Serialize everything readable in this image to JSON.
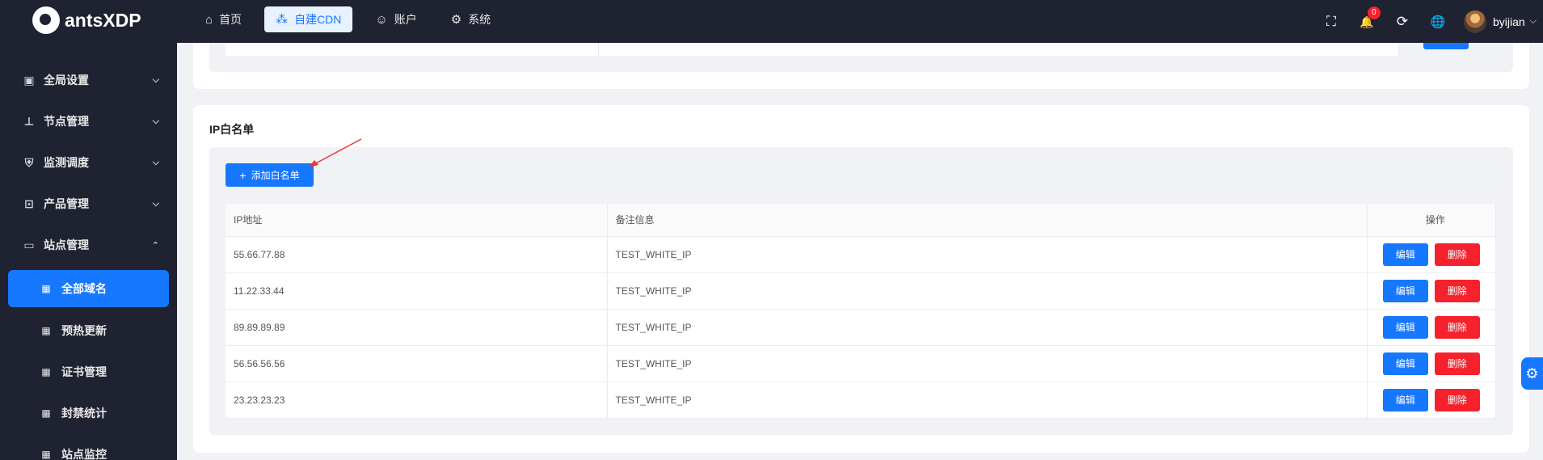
{
  "brand": {
    "name": "antsXDP"
  },
  "topnav": [
    {
      "label": "首页",
      "icon": "home-icon",
      "glyph": "⌂"
    },
    {
      "label": "自建CDN",
      "icon": "network-icon",
      "glyph": "⁂"
    },
    {
      "label": "账户",
      "icon": "user-icon",
      "glyph": "☺"
    },
    {
      "label": "系统",
      "icon": "gear-icon",
      "glyph": "⚙"
    }
  ],
  "header": {
    "notification_count": "0",
    "username": "byijian",
    "icons": {
      "fullscreen": "⛶",
      "bell": "🔔",
      "refresh": "⟳",
      "globe": "🌐",
      "caret": "⌵"
    }
  },
  "sidebar": {
    "items": [
      {
        "label": "全局设置",
        "glyph": "▣",
        "chev": "⌵"
      },
      {
        "label": "节点管理",
        "glyph": "⊥",
        "chev": "⌵"
      },
      {
        "label": "监测调度",
        "glyph": "⛨",
        "chev": "⌵"
      },
      {
        "label": "产品管理",
        "glyph": "⊡",
        "chev": "⌵"
      },
      {
        "label": "站点管理",
        "glyph": "▭",
        "chev": "⌃"
      }
    ],
    "sub_items": [
      {
        "label": "全部域名",
        "glyph": "▦"
      },
      {
        "label": "预热更新",
        "glyph": "▦"
      },
      {
        "label": "证书管理",
        "glyph": "▦"
      },
      {
        "label": "封禁统计",
        "glyph": "▦"
      },
      {
        "label": "站点监控",
        "glyph": "▦"
      }
    ]
  },
  "whitelist": {
    "title": "IP白名单",
    "add_label": "添加白名单",
    "add_glyph": "+",
    "columns": [
      "IP地址",
      "备注信息",
      "操作"
    ],
    "edit_label": "编辑",
    "delete_label": "删除",
    "rows": [
      {
        "ip": "55.66.77.88",
        "note": "TEST_WHITE_IP"
      },
      {
        "ip": "11.22.33.44",
        "note": "TEST_WHITE_IP"
      },
      {
        "ip": "89.89.89.89",
        "note": "TEST_WHITE_IP"
      },
      {
        "ip": "56.56.56.56",
        "note": "TEST_WHITE_IP"
      },
      {
        "ip": "23.23.23.23",
        "note": "TEST_WHITE_IP"
      }
    ]
  },
  "colors": {
    "accent": "#1677ff",
    "danger": "#f5222d",
    "sidebar": "#1f2230"
  },
  "float_gear": "⚙"
}
